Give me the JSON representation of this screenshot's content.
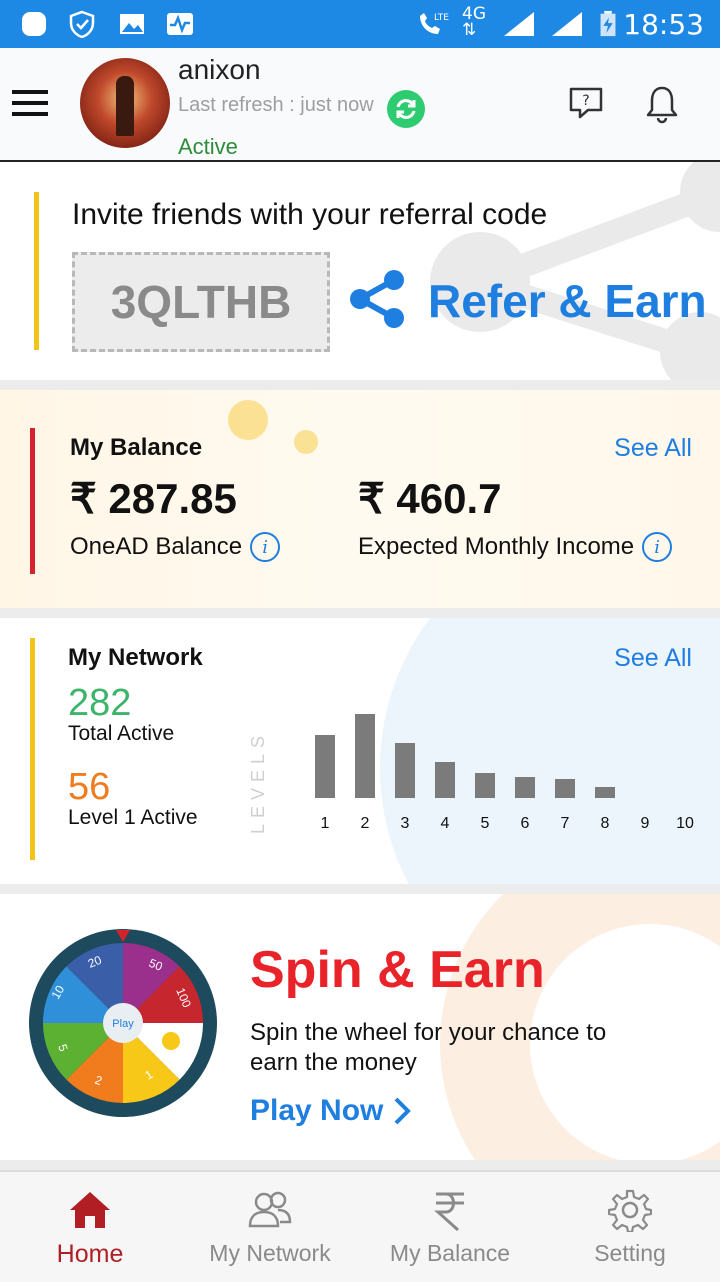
{
  "status_bar": {
    "time": "18:53",
    "network": "4G",
    "lte": "LTE"
  },
  "header": {
    "username": "anixon",
    "refresh_text": "Last refresh : just now",
    "status": "Active"
  },
  "referral": {
    "title": "Invite friends with your referral code",
    "code": "3QLTHB",
    "action": "Refer & Earn"
  },
  "balance": {
    "title": "My Balance",
    "see_all": "See All",
    "oneAD_amount": "₹ 287.85",
    "oneAD_label": "OneAD Balance",
    "expected_amount": "₹ 460.7",
    "expected_label": "Expected Monthly Income"
  },
  "network": {
    "title": "My Network",
    "see_all": "See All",
    "total_active": "282",
    "total_active_label": "Total Active",
    "level1_active": "56",
    "level1_active_label": "Level 1 Active",
    "levels_label": "LEVELS"
  },
  "chart_data": {
    "type": "bar",
    "categories": [
      "1",
      "2",
      "3",
      "4",
      "5",
      "6",
      "7",
      "8",
      "9",
      "10"
    ],
    "values": [
      63,
      84,
      55,
      36,
      25,
      21,
      19,
      11,
      0,
      0
    ],
    "ylabel": "LEVELS"
  },
  "spin": {
    "title": "Spin & Earn",
    "description": "Spin the wheel for your chance to earn the money",
    "play_now": "Play Now",
    "wheel_center": "Play",
    "wheel_labels": [
      "50",
      "100",
      "1",
      "2",
      "5",
      "10",
      "20"
    ]
  },
  "tabs": [
    {
      "label": "Home",
      "icon": "home-icon"
    },
    {
      "label": "My Network",
      "icon": "network-icon"
    },
    {
      "label": "My Balance",
      "icon": "rupee-icon"
    },
    {
      "label": "Setting",
      "icon": "gear-icon"
    }
  ],
  "colors": {
    "accent": "#1e7fe0",
    "status_bar": "#1e88e5",
    "brand_red": "#e8232a",
    "active_green": "#2e8b3a"
  }
}
